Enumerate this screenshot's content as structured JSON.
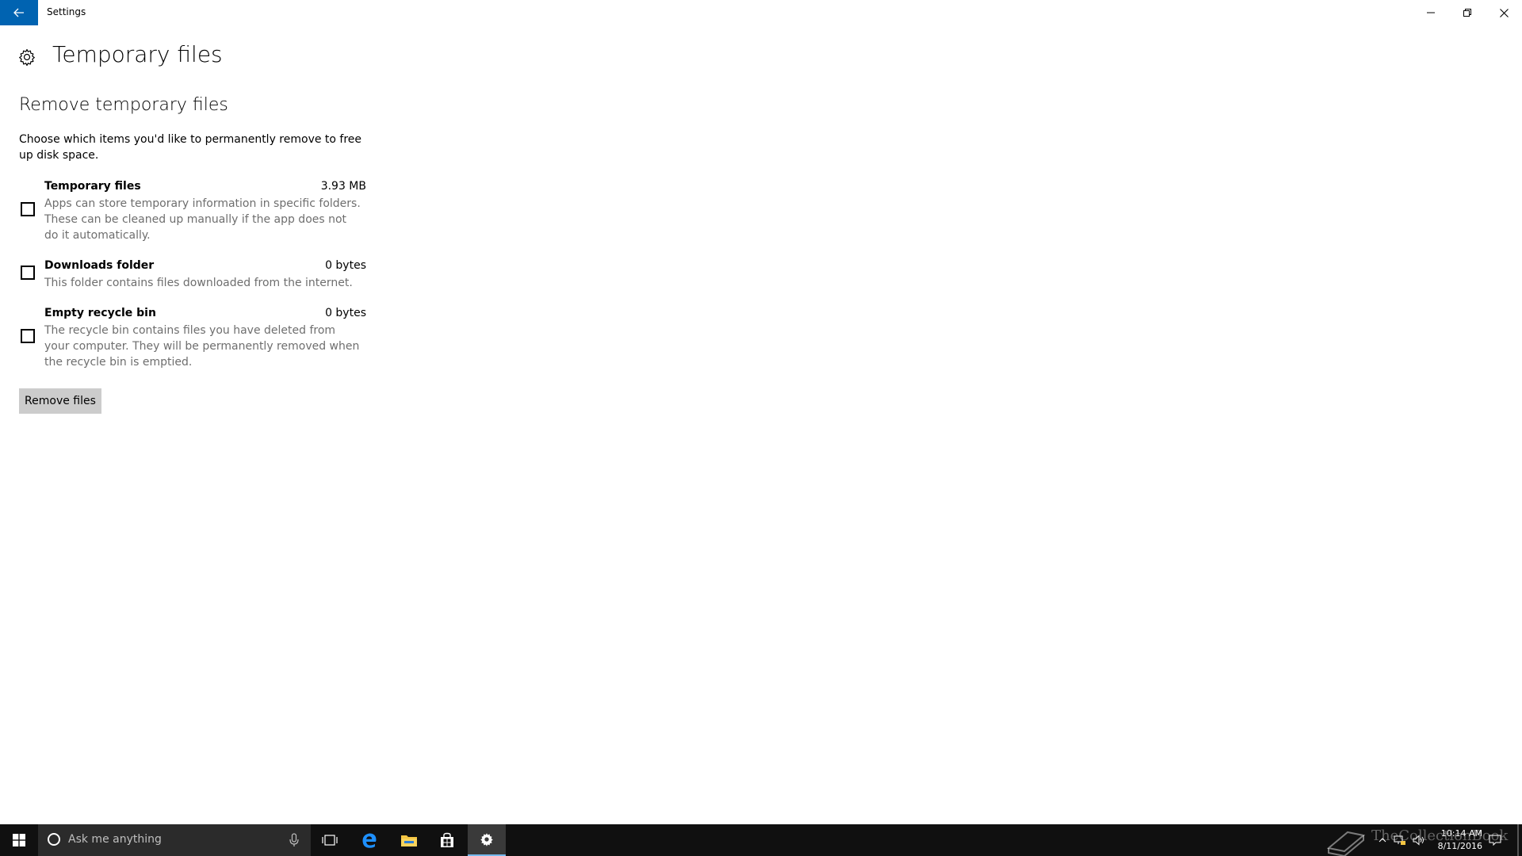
{
  "window": {
    "title": "Settings"
  },
  "page": {
    "title": "Temporary files",
    "section_title": "Remove temporary files",
    "intro": "Choose which items you'd like to permanently remove to free up disk space."
  },
  "items": [
    {
      "name": "Temporary files",
      "size": "3.93 MB",
      "description": "Apps can store temporary information in specific folders. These can be cleaned up manually if the app does not do it automatically.",
      "checked": false
    },
    {
      "name": "Downloads folder",
      "size": "0 bytes",
      "description": "This folder contains files downloaded from the internet.",
      "checked": false
    },
    {
      "name": "Empty recycle bin",
      "size": "0 bytes",
      "description": "The recycle bin contains files you have deleted from your computer. They will be permanently removed when the recycle bin is emptied.",
      "checked": false
    }
  ],
  "actions": {
    "remove_label": "Remove files"
  },
  "taskbar": {
    "search_placeholder": "Ask me anything",
    "clock_time": "10:14 AM",
    "clock_date": "8/11/2016",
    "watermark": "TheCollectionBook"
  },
  "colors": {
    "accent": "#0063b1",
    "button_bg": "#cccccc",
    "taskbar_bg": "#101010",
    "description_text": "#6e6e6e"
  },
  "icons": {
    "back": "arrow-left-icon",
    "page": "gear-icon",
    "start": "windows-logo-icon",
    "search": "cortana-circle-icon",
    "mic": "microphone-icon",
    "task_view": "task-view-icon",
    "edge": "edge-browser-icon",
    "explorer": "file-explorer-icon",
    "store": "store-icon",
    "settings": "gear-icon"
  }
}
